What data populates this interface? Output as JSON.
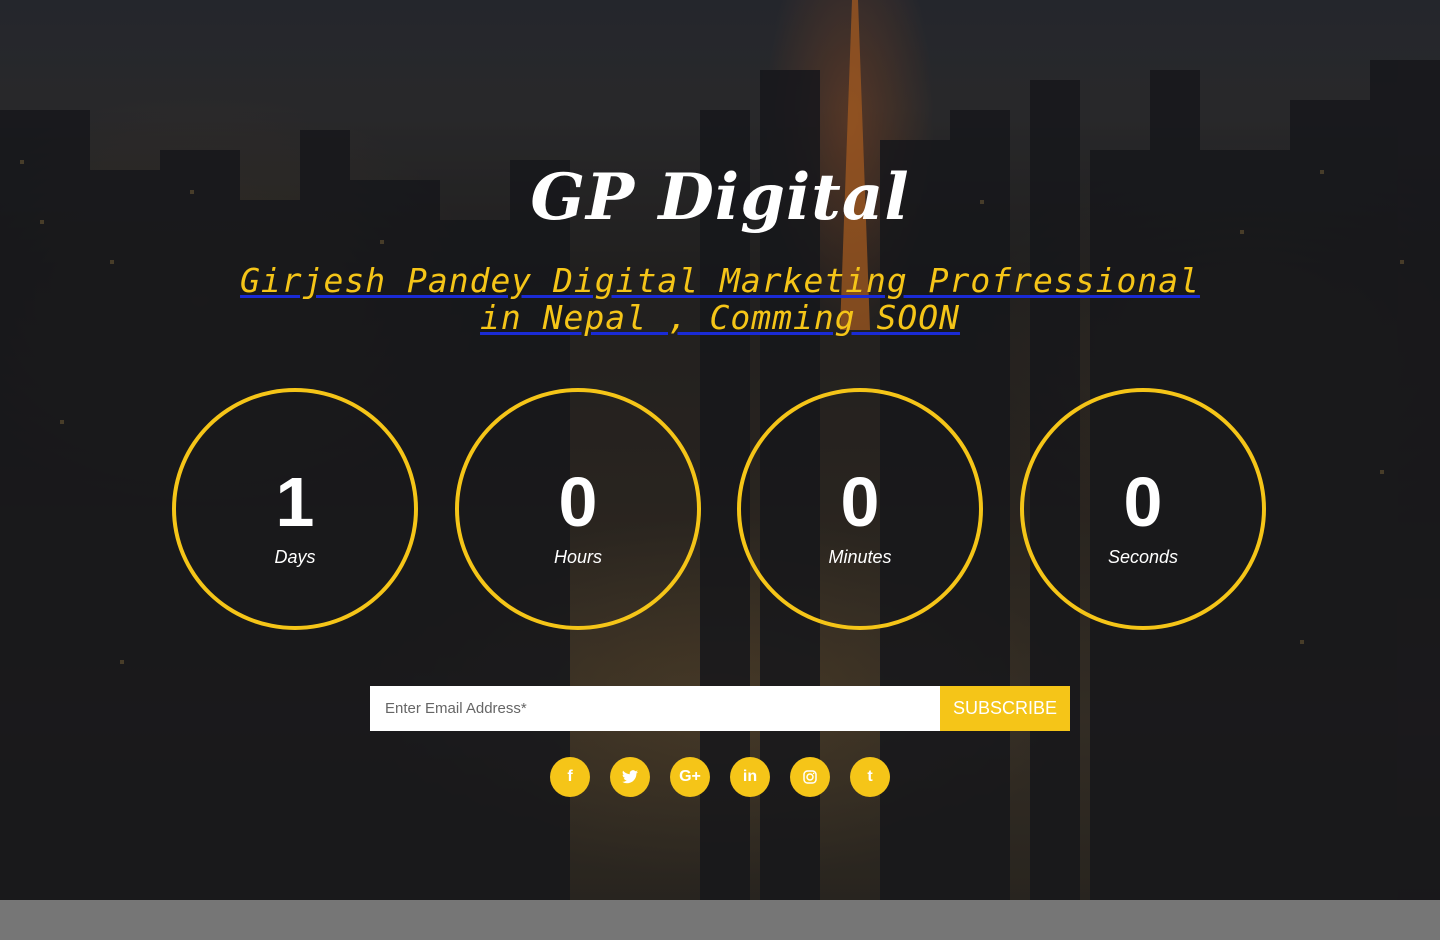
{
  "header": {
    "title": "GP Digital",
    "subtitle": "Girjesh Pandey Digital Marketing Profressional in Nepal , Comming SOON"
  },
  "countdown": [
    {
      "value": "1",
      "label": "Days"
    },
    {
      "value": "0",
      "label": "Hours"
    },
    {
      "value": "0",
      "label": "Minutes"
    },
    {
      "value": "0",
      "label": "Seconds"
    }
  ],
  "subscribe": {
    "placeholder": "Enter Email Address*",
    "button_label": "SUBSCRIBE"
  },
  "social": [
    {
      "icon": "facebook-icon",
      "glyph": "f"
    },
    {
      "icon": "twitter-icon",
      "glyph": ""
    },
    {
      "icon": "google-plus-icon",
      "glyph": "G+"
    },
    {
      "icon": "linkedin-icon",
      "glyph": "in"
    },
    {
      "icon": "instagram-icon",
      "glyph": ""
    },
    {
      "icon": "tumblr-icon",
      "glyph": "t"
    }
  ],
  "colors": {
    "accent": "#f5c518",
    "subtitle_underline": "#1a2bd6",
    "footer": "#767676"
  }
}
